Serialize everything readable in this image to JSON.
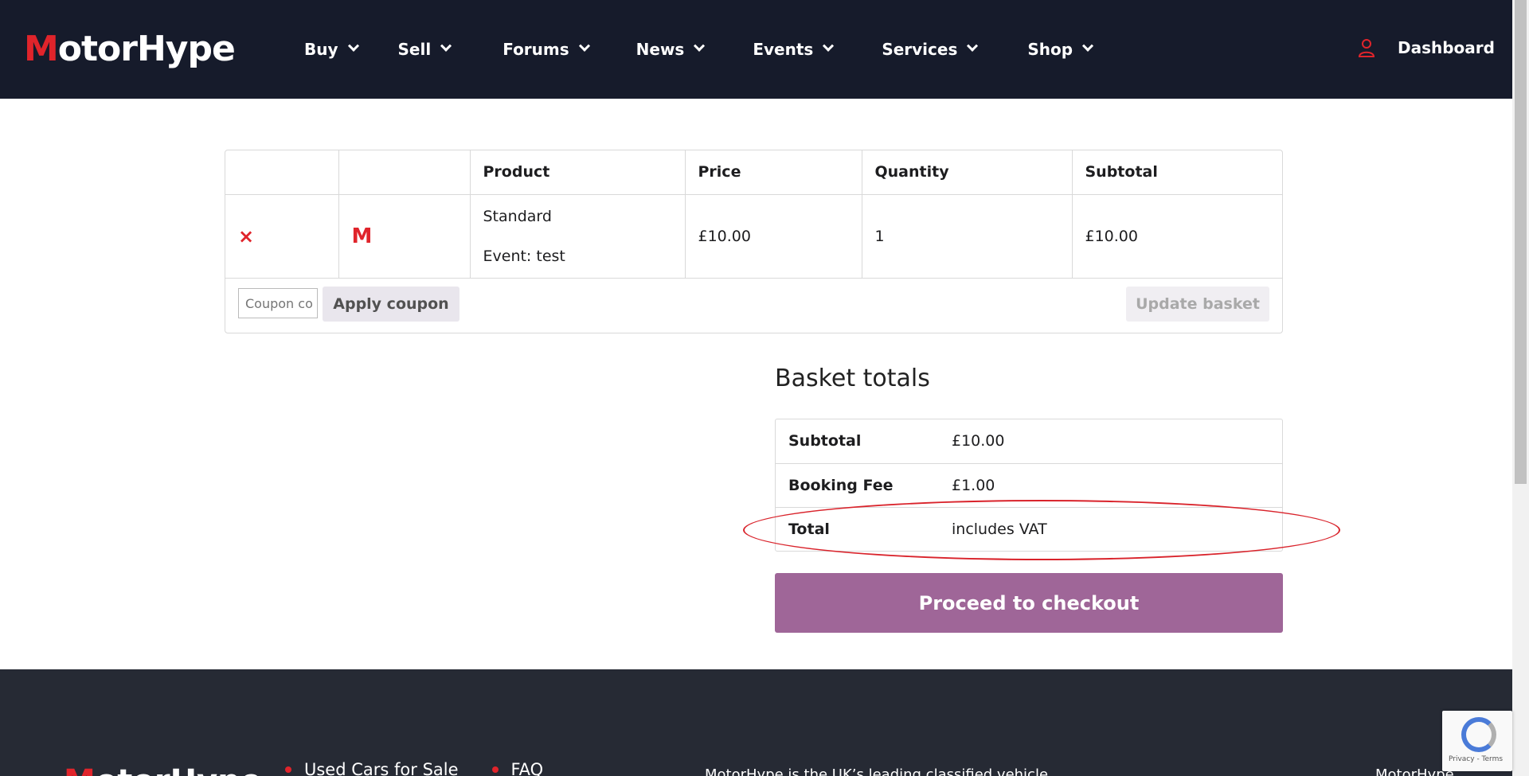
{
  "header": {
    "logo_first": "M",
    "logo_rest": "otorHype",
    "nav": [
      "Buy",
      "Sell",
      "Forums",
      "News",
      "Events",
      "Services",
      "Shop"
    ],
    "dashboard_label": "Dashboard"
  },
  "cart": {
    "columns": [
      "",
      "",
      "Product",
      "Price",
      "Quantity",
      "Subtotal"
    ],
    "rows": [
      {
        "remove_label": "×",
        "thumbnail_letter": "M",
        "product_name": "Standard",
        "product_meta": "Event: test",
        "price": "£10.00",
        "quantity": "1",
        "subtotal": "£10.00"
      }
    ],
    "coupon_placeholder": "Coupon co",
    "apply_label": "Apply coupon",
    "update_label": "Update basket"
  },
  "totals": {
    "title": "Basket totals",
    "rows": [
      {
        "label": "Subtotal",
        "value": "£10.00"
      },
      {
        "label": "Booking Fee",
        "value": "£1.00"
      },
      {
        "label": "Total",
        "value": "includes VAT"
      }
    ],
    "checkout_label": "Proceed to checkout"
  },
  "footer": {
    "logo_first": "M",
    "logo_rest": "otorHype",
    "links": [
      "Used Cars for Sale",
      "FAQ"
    ],
    "description": "MotorHype is the UK’s leading classified vehicle",
    "right_text": "MotorHype"
  },
  "recaptcha": {
    "text": "Privacy - Terms"
  },
  "colors": {
    "header_bg": "#161b2b",
    "accent_red": "#e0242b",
    "checkout_purple": "#9f6698",
    "footer_bg": "#262a34"
  }
}
